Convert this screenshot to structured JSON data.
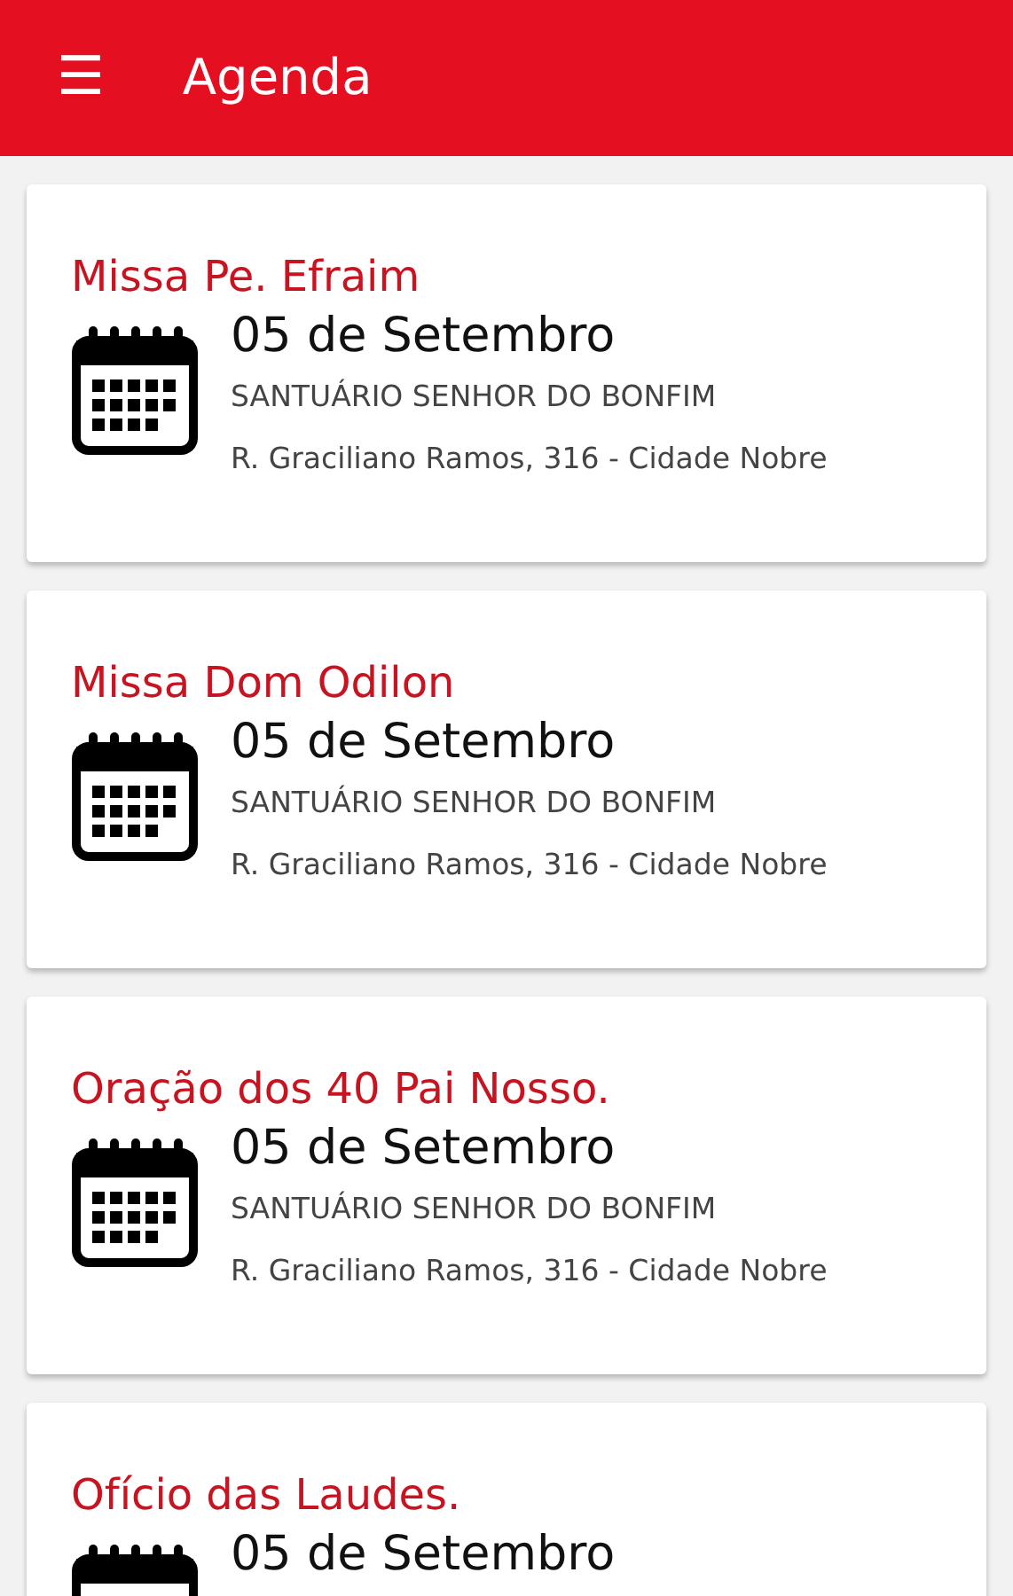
{
  "app_bar": {
    "menu_icon": "☰",
    "title": "Agenda"
  },
  "events": [
    {
      "title": "Missa Pe. Efraim",
      "date": "05 de Setembro",
      "place": "SANTUÁRIO SENHOR DO BONFIM",
      "address": "R. Graciliano Ramos, 316 - Cidade Nobre"
    },
    {
      "title": "Missa Dom Odilon",
      "date": "05 de Setembro",
      "place": "SANTUÁRIO SENHOR DO BONFIM",
      "address": "R. Graciliano Ramos, 316 - Cidade Nobre"
    },
    {
      "title": "Oração dos 40 Pai Nosso.",
      "date": "05 de Setembro",
      "place": "SANTUÁRIO SENHOR DO BONFIM",
      "address": "R. Graciliano Ramos, 316 - Cidade Nobre"
    },
    {
      "title": "Ofício das Laudes.",
      "date": "05 de Setembro"
    }
  ]
}
